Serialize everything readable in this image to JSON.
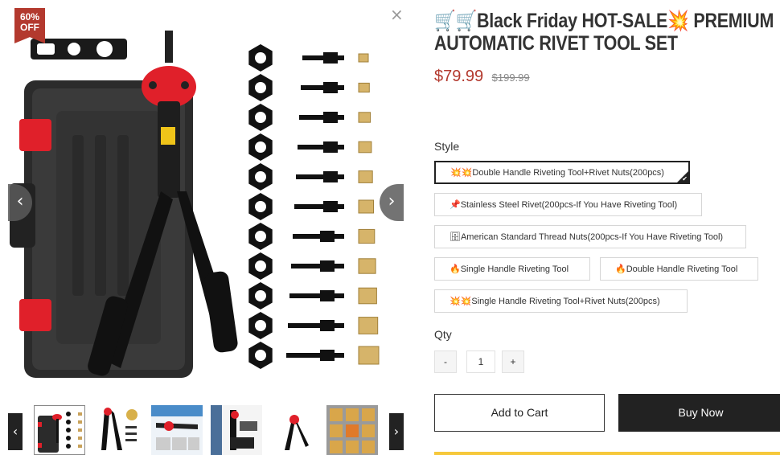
{
  "badge": {
    "percent": "60%",
    "off": "OFF"
  },
  "gallery": {
    "close_glyph": "×",
    "prev_glyph": "‹",
    "next_glyph": "›",
    "thumb_prev_glyph": "‹",
    "thumb_next_glyph": "›"
  },
  "product": {
    "title": "🛒🛒Black Friday HOT-SALE💥 PREMIUM AUTOMATIC RIVET TOOL SET",
    "price": "$79.99",
    "compare_price": "$199.99"
  },
  "style": {
    "label": "Style",
    "options": [
      {
        "icon": "💥💥",
        "label": "Double Handle Riveting Tool+Rivet Nuts(200pcs)",
        "selected": true
      },
      {
        "icon": "📌",
        "label": "Stainless Steel Rivet(200pcs-If You Have Riveting Tool)",
        "selected": false
      },
      {
        "icon": "🗄",
        "label": "American Standard Thread Nuts(200pcs-If You Have Riveting Tool)",
        "selected": false
      },
      {
        "icon": "🔥",
        "label": "Single Handle Riveting Tool",
        "selected": false
      },
      {
        "icon": "🔥",
        "label": "Double Handle Riveting Tool",
        "selected": false
      },
      {
        "icon": "💥💥",
        "label": "Single Handle Riveting Tool+Rivet Nuts(200pcs)",
        "selected": false
      }
    ]
  },
  "qty": {
    "label": "Qty",
    "minus": "-",
    "value": "1",
    "plus": "+"
  },
  "buttons": {
    "add_to_cart": "Add to Cart",
    "buy_now": "Buy Now"
  },
  "colors": {
    "accent_red": "#b3392e",
    "dark": "#222222",
    "highlight_yellow": "#f6c83b"
  }
}
